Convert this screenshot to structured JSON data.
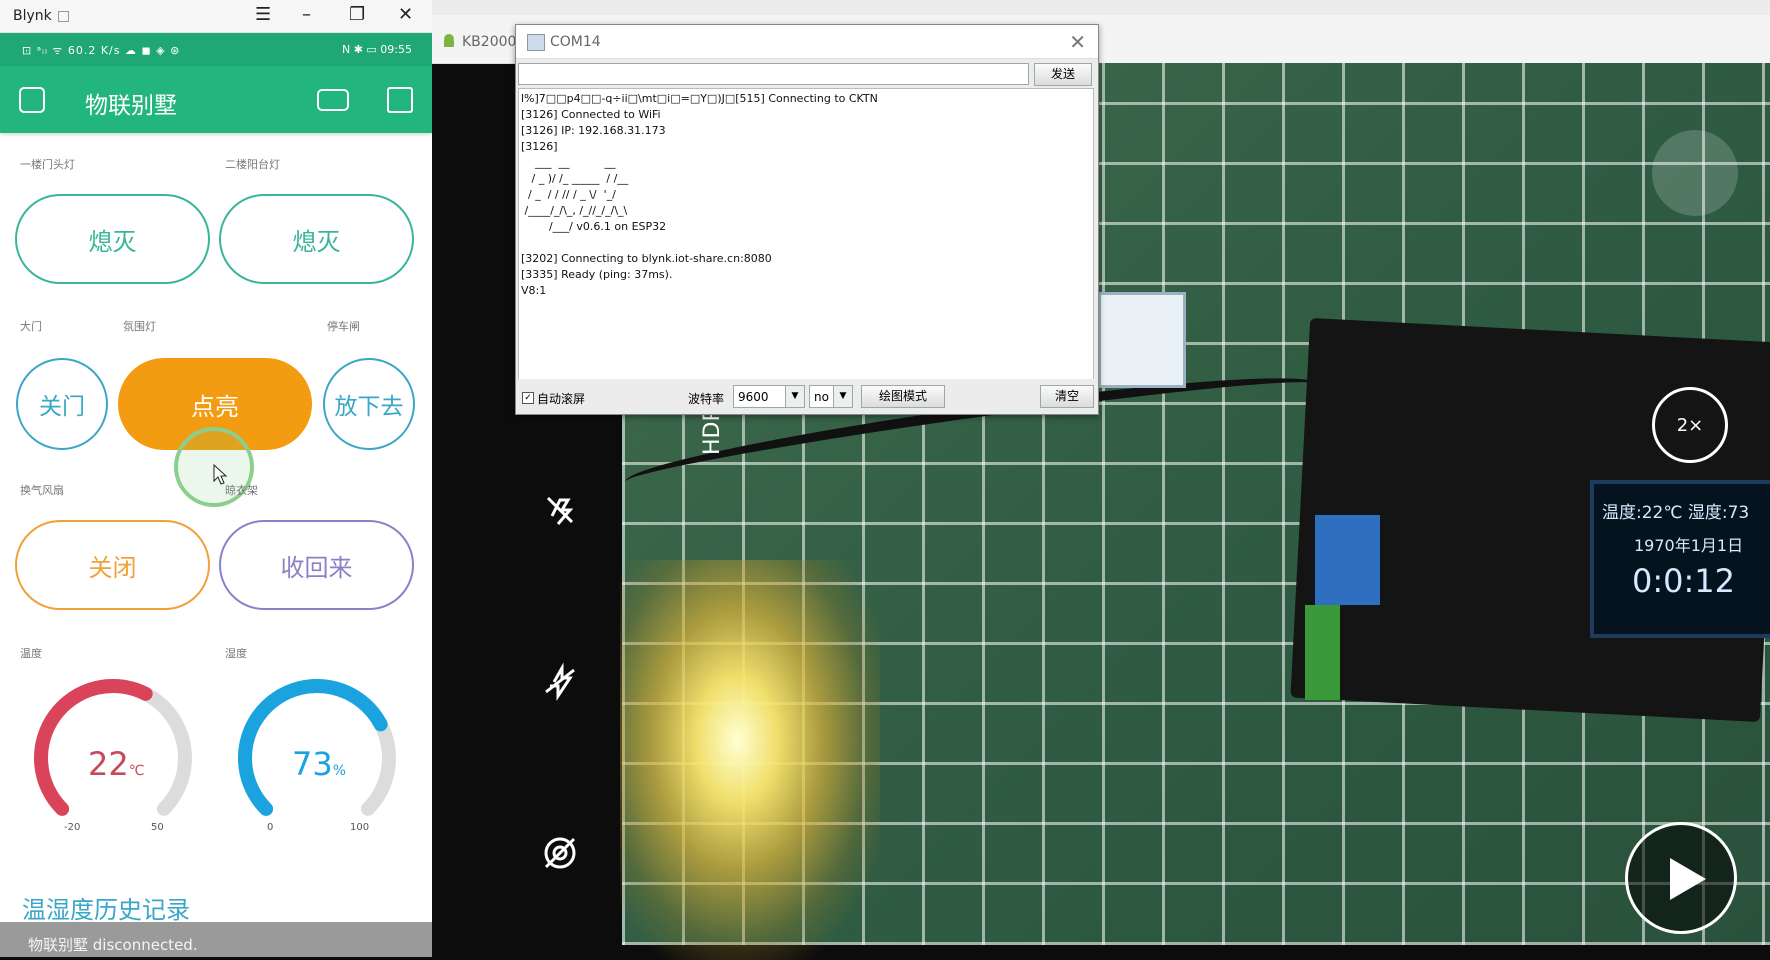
{
  "blynk": {
    "window_title": "Blynk",
    "statusbar_left": "⊡ ᵃᵢₗ ᯤ 60.2 K/s ☁ ◼ ◈ ⊛",
    "statusbar_right": "N ✱ ▭ 09:55",
    "project_title": "物联别墅",
    "widgets": {
      "label_door_light": "一楼门头灯",
      "label_balcony_light": "二楼阳台灯",
      "btn_door_light": "熄灭",
      "btn_balcony_light": "熄灭",
      "label_gate": "大门",
      "label_ambient": "氛围灯",
      "label_parking": "停车闸",
      "btn_gate": "关门",
      "btn_ambient": "点亮",
      "btn_parking": "放下去",
      "label_fan": "换气风扇",
      "label_rack": "晾衣架",
      "btn_fan": "关闭",
      "btn_rack": "收回来",
      "label_temp": "温度",
      "label_hum": "湿度"
    },
    "gauges": {
      "temp": {
        "value": "22",
        "unit": "℃",
        "min": "-20",
        "max": "50",
        "color": "#d9445a",
        "level": 0.6
      },
      "humidity": {
        "value": "73",
        "unit": "%",
        "min": "0",
        "max": "100",
        "color": "#1aa3de",
        "level": 0.73
      }
    },
    "history_title": "温湿度历史记录",
    "disconnected_text": "物联别墅 disconnected."
  },
  "camera": {
    "tab_title": "KB2000",
    "hdr_label": "HDR",
    "zoom_label": "2×",
    "oled_line1": "温度:22℃ 湿度:73",
    "oled_line2": "1970年1月1日",
    "oled_line3": "0:0:12"
  },
  "serial": {
    "title": "COM14",
    "send_button": "发送",
    "output": "l%]7□□p4□□-q÷ii□\\mt□i□=□Y□)J□[515] Connecting to CKTN\n[3126] Connected to WiFi\n[3126] IP: 192.168.31.173\n[3126]\n    ___  __          __\n   / _ )/ /_ _____  / /__\n  / _  / / // / _ \\/  '_/\n /____/_/\\_, /_//_/_/\\_\\\n        /___/ v0.6.1 on ESP32\n\n[3202] Connecting to blynk.iot-share.cn:8080\n[3335] Ready (ping: 37ms).\nV8:1",
    "autoscroll_label": "自动滚屏",
    "baud_label": "波特率",
    "baud_value": "9600",
    "parity_value": "no",
    "plot_button": "绘图模式",
    "clear_button": "清空"
  }
}
